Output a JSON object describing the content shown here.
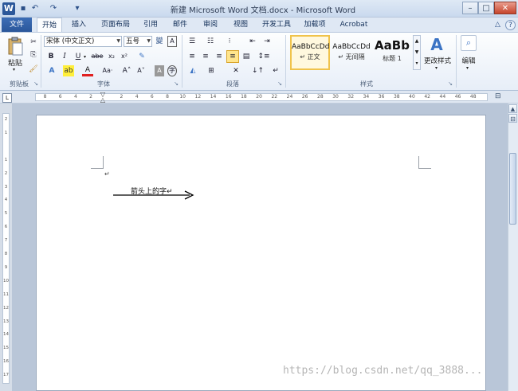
{
  "titlebar": {
    "title": "新建 Microsoft Word 文档.docx - Microsoft Word",
    "qat": {
      "save": "▪",
      "undo": "↶",
      "redo": "↷",
      "customize": "▾"
    },
    "controls": {
      "minimize": "–",
      "maximize": "□",
      "close": "✕"
    },
    "ribbon_minimize": "△",
    "help": "?"
  },
  "tabs": {
    "file": "文件",
    "items": [
      "开始",
      "插入",
      "页面布局",
      "引用",
      "邮件",
      "审阅",
      "视图",
      "开发工具",
      "加载项",
      "Acrobat"
    ]
  },
  "clipboard": {
    "paste": "粘贴",
    "group": "剪贴板"
  },
  "font": {
    "family": "宋体 (中文正文)",
    "size": "五号",
    "bold": "B",
    "italic": "I",
    "underline": "U",
    "strike": "abe",
    "subscript": "x₂",
    "superscript": "x²",
    "font_color": "A",
    "grow": "A˄",
    "shrink": "A˅",
    "aa": "Aa·",
    "group": "字体"
  },
  "paragraph": {
    "group": "段落"
  },
  "styles": {
    "group": "样式",
    "cards": [
      {
        "sample": "AaBbCcDd",
        "name": "↵ 正文"
      },
      {
        "sample": "AaBbCcDd",
        "name": "↵ 无间隔"
      },
      {
        "sample": "AaBb",
        "name": "标题 1"
      }
    ],
    "change_styles": "更改样式"
  },
  "editing": {
    "label": "编辑"
  },
  "ruler": {
    "ticks": [
      "8",
      "6",
      "4",
      "2",
      "",
      "2",
      "4",
      "6",
      "8",
      "10",
      "12",
      "14",
      "16",
      "18",
      "20",
      "22",
      "24",
      "26",
      "28",
      "30",
      "32",
      "34",
      "36",
      "38",
      "40",
      "42",
      "44",
      "46",
      "48"
    ]
  },
  "vruler": {
    "ticks": [
      "2",
      "1",
      "",
      "1",
      "2",
      "3",
      "4",
      "5",
      "6",
      "7",
      "8",
      "9",
      "10",
      "11",
      "12",
      "13",
      "14",
      "15",
      "16",
      "17"
    ]
  },
  "document": {
    "paragraph_mark": "↵",
    "arrow_text": "箭头上的字↵"
  },
  "watermark": "https://blog.csdn.net/qq_3888...",
  "colors": {
    "file_tab": "#2a5699",
    "accent": "#f0c34b"
  }
}
